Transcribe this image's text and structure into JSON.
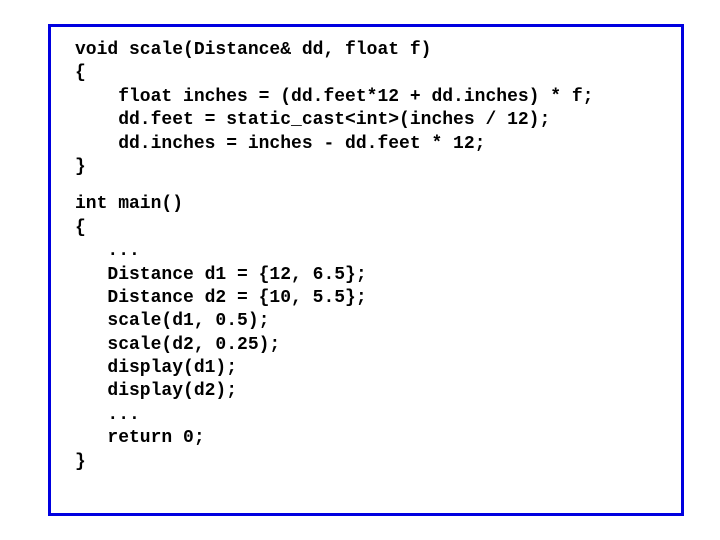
{
  "code": {
    "block1": "void scale(Distance& dd, float f)\n{\n    float inches = (dd.feet*12 + dd.inches) * f;\n    dd.feet = static_cast<int>(inches / 12);\n    dd.inches = inches - dd.feet * 12;\n}",
    "block2": "int main()\n{\n   ...\n   Distance d1 = {12, 6.5};\n   Distance d2 = {10, 5.5};\n   scale(d1, 0.5);\n   scale(d2, 0.25);\n   display(d1);\n   display(d2);\n   ...\n   return 0;\n}"
  }
}
